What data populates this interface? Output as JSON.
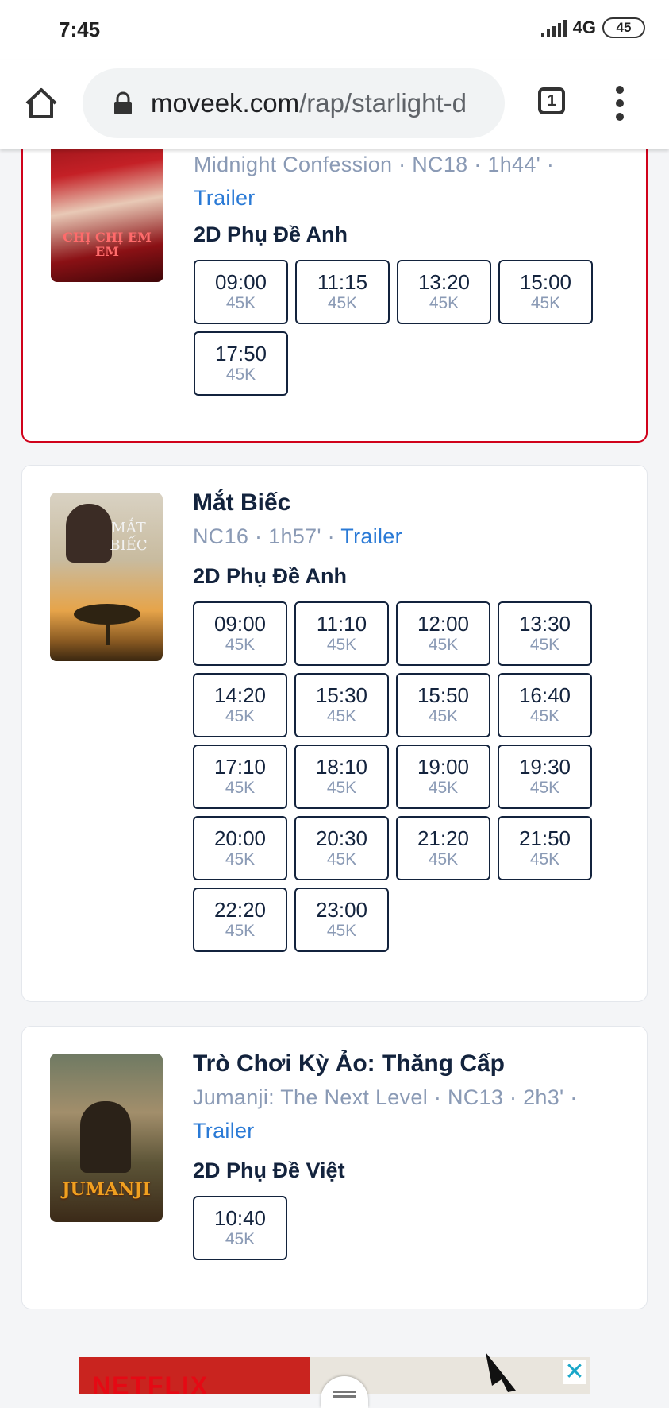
{
  "status_bar": {
    "time": "7:45",
    "network": "4G",
    "battery": "45"
  },
  "browser": {
    "url_host": "moveek.com",
    "url_path": "/rap/starlight-d",
    "tab_count": "1",
    "icons": [
      "home-icon",
      "lock-icon",
      "tabs-icon",
      "menu-icon"
    ]
  },
  "movies": [
    {
      "title": "",
      "original_title": "Midnight Confession",
      "rating": "NC18",
      "duration": "1h44'",
      "trailer_label": "Trailer",
      "format": "2D Phụ Đề Anh",
      "poster_text": "CHỊ CHỊ EM EM",
      "showtimes": [
        {
          "time": "09:00",
          "price": "45K"
        },
        {
          "time": "11:15",
          "price": "45K"
        },
        {
          "time": "13:20",
          "price": "45K"
        },
        {
          "time": "15:00",
          "price": "45K"
        },
        {
          "time": "17:50",
          "price": "45K"
        }
      ]
    },
    {
      "title": "Mắt Biếc",
      "original_title": "",
      "rating": "NC16",
      "duration": "1h57'",
      "trailer_label": "Trailer",
      "format": "2D Phụ Đề Anh",
      "poster_text": "MẮT BIẾC",
      "showtimes": [
        {
          "time": "09:00",
          "price": "45K"
        },
        {
          "time": "11:10",
          "price": "45K"
        },
        {
          "time": "12:00",
          "price": "45K"
        },
        {
          "time": "13:30",
          "price": "45K"
        },
        {
          "time": "14:20",
          "price": "45K"
        },
        {
          "time": "15:30",
          "price": "45K"
        },
        {
          "time": "15:50",
          "price": "45K"
        },
        {
          "time": "16:40",
          "price": "45K"
        },
        {
          "time": "17:10",
          "price": "45K"
        },
        {
          "time": "18:10",
          "price": "45K"
        },
        {
          "time": "19:00",
          "price": "45K"
        },
        {
          "time": "19:30",
          "price": "45K"
        },
        {
          "time": "20:00",
          "price": "45K"
        },
        {
          "time": "20:30",
          "price": "45K"
        },
        {
          "time": "21:20",
          "price": "45K"
        },
        {
          "time": "21:50",
          "price": "45K"
        },
        {
          "time": "22:20",
          "price": "45K"
        },
        {
          "time": "23:00",
          "price": "45K"
        }
      ]
    },
    {
      "title": "Trò Chơi Kỳ Ảo: Thăng Cấp",
      "original_title": "Jumanji: The Next Level",
      "rating": "NC13",
      "duration": "2h3'",
      "trailer_label": "Trailer",
      "format": "2D Phụ Đề Việt",
      "poster_text": "JUMANJI",
      "showtimes": [
        {
          "time": "10:40",
          "price": "45K"
        }
      ]
    }
  ],
  "ad": {
    "brand": "NETFLIX",
    "close_label": "✕"
  },
  "colors": {
    "accent_blue": "#2a7ad6",
    "selected_border": "#d0021b",
    "text_dark": "#13233d",
    "text_muted": "#8a9ab5"
  }
}
